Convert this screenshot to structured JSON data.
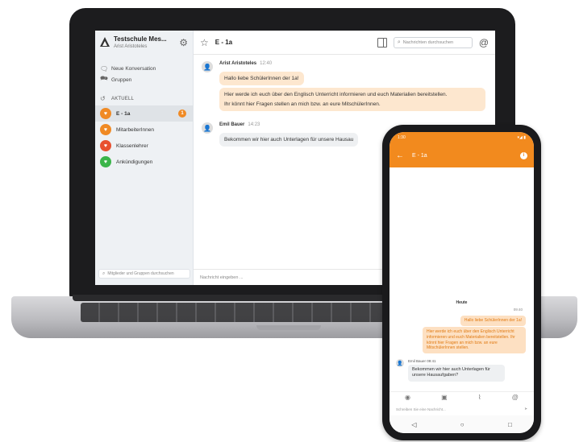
{
  "laptop": {
    "brand_name": "Testschule Mes...",
    "brand_user": "Arist Aristoteles",
    "nav": [
      {
        "label": "Neue Konversation",
        "icon": "chat-plus-icon"
      },
      {
        "label": "Gruppen",
        "icon": "groups-icon"
      }
    ],
    "section_label": "AKTUELL",
    "channels": [
      {
        "label": "E - 1a",
        "color": "#f08a24",
        "badge": "1"
      },
      {
        "label": "MitarbeiterInnen",
        "color": "#f08a24"
      },
      {
        "label": "Klassenlehrer",
        "color": "#e8502f"
      },
      {
        "label": "Ankündigungen",
        "color": "#3bb54a"
      }
    ],
    "sidebar_search_placeholder": "Mitglieder und Gruppen durchsuchen",
    "channel_title": "E - 1a",
    "search_placeholder": "Nachrichten durchsuchen",
    "messages": [
      {
        "author": "Arist Aristoteles",
        "time": "12:40",
        "bubbles": [
          "Hallo liebe SchülerInnen der 1a!",
          "Hier werde ich euch über den Englisch Unterricht informieren und euch Materialien bereitstellen.",
          "Ihr könnt hier Fragen stellen an mich bzw. an eure MitschülerInnen."
        ]
      },
      {
        "author": "Emil Bauer",
        "time": "14:23",
        "bubbles": [
          "Bekommen wir hier auch Unterlagen für unsere Hausau"
        ]
      }
    ],
    "composer_placeholder": "Nachricht eingeben ..."
  },
  "phone": {
    "status_left": "1:30",
    "status_right": "▾◢ ▮",
    "title": "E - 1a",
    "today": "Heute",
    "out_time": "09:40",
    "out_bubbles": [
      "Hallo liebe SchülerInnen der 1a!",
      "Hier werde ich euch über den Englisch Unterricht informieren und euch Materialien bereitstellen. Ihr könnt hier Fragen an mich bzw. an eure MitschülerInnen stellen."
    ],
    "in_name": "Emil Bauer 09:41",
    "in_text": "Bekommen wir hier auch Unterlagen für unsere Hausaufgaben?",
    "input_placeholder": "Schreiben Sie eine Nachricht..."
  },
  "colors": {
    "accent": "#f28a1e",
    "bubble_out": "#fde7cf",
    "bubble_in": "#eef0f2"
  }
}
